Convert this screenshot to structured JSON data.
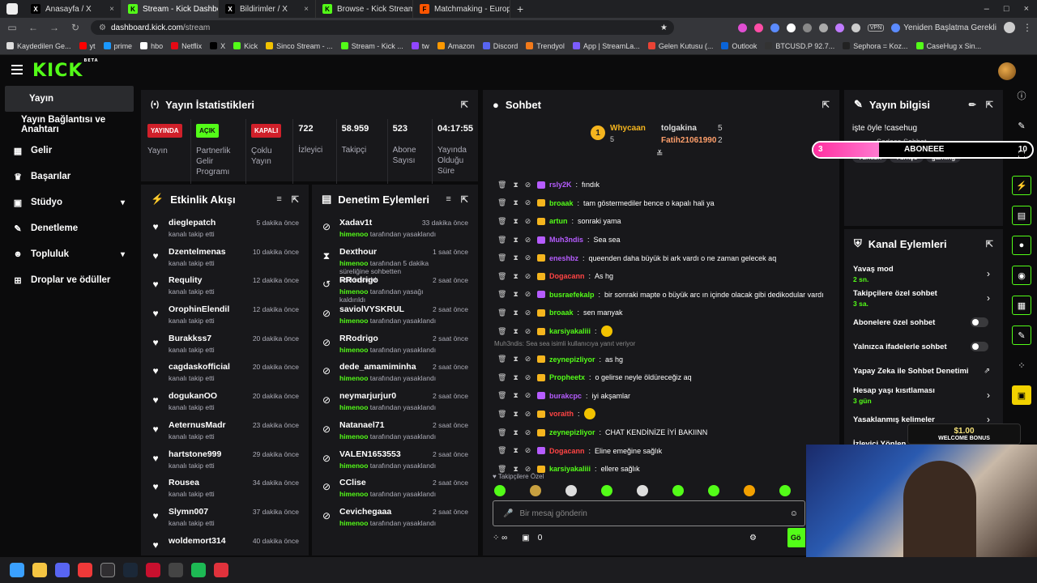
{
  "browser": {
    "tabs": [
      {
        "label": "Anasayfa / X",
        "fav": "X",
        "color": "#000000"
      },
      {
        "label": "Stream - Kick Dashboard",
        "fav": "K",
        "color": "#53fc18",
        "active": true
      },
      {
        "label": "Bildirimler / X",
        "fav": "X",
        "color": "#000000"
      },
      {
        "label": "Browse - Kick Streaming",
        "fav": "K",
        "color": "#53fc18"
      },
      {
        "label": "Matchmaking - Europe 5v5",
        "fav": "F",
        "color": "#ff5500"
      }
    ],
    "url_domain": "dashboard.kick.com",
    "url_path": "/stream",
    "vpn_label": "VPN",
    "restart_label": "Yeniden Başlatma Gerekli",
    "bookmarks": [
      "Kaydedilen Ge...",
      "yt",
      "prime",
      "hbo",
      "Netflix",
      "X",
      "Kick",
      "Sinco Stream - ...",
      "Stream - Kick ...",
      "tw",
      "Amazon",
      "Discord",
      "Trendyol",
      "App | StreamLa...",
      "Gelen Kutusu (...",
      "Outlook",
      "BTCUSD.P 92.7...",
      "Sephora = Koz...",
      "CaseHug x Sin..."
    ]
  },
  "app": {
    "logo": "KICK",
    "logo_sup": "BETA",
    "sidebar": [
      {
        "label": "Yayın",
        "icon": "broadcast-icon",
        "glyph": "▸"
      },
      {
        "label": "Yayın Bağlantısı ve Anahtarı",
        "icon": "",
        "glyph": ""
      },
      {
        "label": "Gelir",
        "icon": "revenue-icon",
        "glyph": "▦"
      },
      {
        "label": "Başarılar",
        "icon": "trophy-icon",
        "glyph": "♛"
      },
      {
        "label": "Stüdyo",
        "icon": "studio-icon",
        "glyph": "▣",
        "chev": "⌄"
      },
      {
        "label": "Denetleme",
        "icon": "wrench-icon",
        "glyph": "✎"
      },
      {
        "label": "Topluluk",
        "icon": "community-icon",
        "glyph": "☻",
        "chev": "⌄"
      },
      {
        "label": "Droplar ve ödüller",
        "icon": "gift-icon",
        "glyph": "⊞"
      }
    ]
  },
  "stats": {
    "title": "Yayın İstatistikleri",
    "items": [
      {
        "badge": "YAYINDA",
        "badge_style": "red",
        "label": "Yayın"
      },
      {
        "badge": "AÇIK",
        "badge_style": "green",
        "label": "Partnerlik Gelir Programı"
      },
      {
        "badge": "KAPALI",
        "badge_style": "red",
        "label": "Çoklu Yayın"
      },
      {
        "value": "722",
        "label": "İzleyici"
      },
      {
        "value": "58.959",
        "label": "Takipçi"
      },
      {
        "value": "523",
        "label": "Abone Sayısı"
      },
      {
        "value": "04:17:55",
        "label": "Yayında Olduğu Süre"
      }
    ]
  },
  "activity": {
    "title": "Etkinlik Akışı",
    "items": [
      {
        "name": "dieglepatch",
        "sub": "kanalı takip etti",
        "time": "5 dakika önce"
      },
      {
        "name": "Dzentelmenas",
        "sub": "kanalı takip etti",
        "time": "10 dakika önce"
      },
      {
        "name": "Requlity",
        "sub": "kanalı takip etti",
        "time": "12 dakika önce"
      },
      {
        "name": "OrophinElendil",
        "sub": "kanalı takip etti",
        "time": "12 dakika önce"
      },
      {
        "name": "Burakkss7",
        "sub": "kanalı takip etti",
        "time": "20 dakika önce"
      },
      {
        "name": "cagdaskofficial",
        "sub": "kanalı takip etti",
        "time": "20 dakika önce"
      },
      {
        "name": "dogukanOO",
        "sub": "kanalı takip etti",
        "time": "20 dakika önce"
      },
      {
        "name": "AeternusMadr",
        "sub": "kanalı takip etti",
        "time": "23 dakika önce"
      },
      {
        "name": "hartstone999",
        "sub": "kanalı takip etti",
        "time": "29 dakika önce"
      },
      {
        "name": "Rousea",
        "sub": "kanalı takip etti",
        "time": "34 dakika önce"
      },
      {
        "name": "Slymn007",
        "sub": "kanalı takip etti",
        "time": "37 dakika önce"
      },
      {
        "name": "woldemort314",
        "sub": "",
        "time": "40 dakika önce"
      }
    ]
  },
  "moderation": {
    "title": "Denetim Eylemleri",
    "items": [
      {
        "name": "Xadav1t",
        "mod": "himenoo",
        "sub": " tarafından yasaklandı",
        "time": "33 dakika önce",
        "glyph": "⊘"
      },
      {
        "name": "Dexthour",
        "mod": "himenoo",
        "sub": " tarafından 5 dakika süreliğine sohbetten uzaklaştırıldı",
        "time": "1 saat önce",
        "glyph": "⧗"
      },
      {
        "name": "RRodrigo",
        "mod": "himenoo",
        "sub": " tarafından yasağı kaldırıldı",
        "time": "2 saat önce",
        "glyph": "↺"
      },
      {
        "name": "saviolVYSKRUL",
        "mod": "himenoo",
        "sub": " tarafından yasaklandı",
        "time": "2 saat önce",
        "glyph": "⊘"
      },
      {
        "name": "RRodrigo",
        "mod": "himenoo",
        "sub": " tarafından yasaklandı",
        "time": "2 saat önce",
        "glyph": "⊘"
      },
      {
        "name": "dede_amamiminha",
        "mod": "himenoo",
        "sub": " tarafından yasaklandı",
        "time": "2 saat önce",
        "glyph": "⊘"
      },
      {
        "name": "neymarjurjur0",
        "mod": "himenoo",
        "sub": " tarafından yasaklandı",
        "time": "2 saat önce",
        "glyph": "⊘"
      },
      {
        "name": "Natanael71",
        "mod": "himenoo",
        "sub": " tarafından yasaklandı",
        "time": "2 saat önce",
        "glyph": "⊘"
      },
      {
        "name": "VALEN1653553",
        "mod": "himenoo",
        "sub": " tarafından yasaklandı",
        "time": "2 saat önce",
        "glyph": "⊘"
      },
      {
        "name": "CClise",
        "mod": "himenoo",
        "sub": " tarafından yasaklandı",
        "time": "2 saat önce",
        "glyph": "⊘"
      },
      {
        "name": "Cevichegaaa",
        "mod": "himenoo",
        "sub": " tarafından yasaklandı",
        "time": "2 saat önce",
        "glyph": "⊘"
      }
    ]
  },
  "chat": {
    "title": "Sohbet",
    "top": {
      "rank": "1",
      "name": "Whycaan",
      "count": "5",
      "second": "tolgakina",
      "second_count": "5",
      "third": "Fatih21061990",
      "third_count": "2"
    },
    "messages": [
      {
        "user": "rsly2K",
        "color": "#b65cff",
        "text": "fındık"
      },
      {
        "user": "broaak",
        "color": "#53fc18",
        "text": "tam göstermediler bence o kapalı hali ya"
      },
      {
        "user": "artun",
        "color": "#53fc18",
        "text": "sonraki yama"
      },
      {
        "user": "Muh3ndis",
        "color": "#b65cff",
        "text": "Sea sea"
      },
      {
        "user": "eneshbz",
        "color": "#b65cff",
        "text": "queenden daha büyük bi ark vardı o ne zaman gelecek aq"
      },
      {
        "user": "Dogacann",
        "color": "#ff4444",
        "text": "As hg"
      },
      {
        "user": "busraefekalp",
        "color": "#53fc18",
        "text": "bir sonraki mapte o büyük arc ın içinde olacak gibi dedikodular vardı"
      },
      {
        "user": "broaak",
        "color": "#53fc18",
        "text": "sen manyak"
      },
      {
        "user": "karsiyakaliii",
        "color": "#53fc18",
        "text": ""
      },
      {
        "reply": "Muh3ndis: Sea sea isimli kullanıcıya yanıt veriyor"
      },
      {
        "user": "zeynepizliyor",
        "color": "#53fc18",
        "text": "as hg"
      },
      {
        "user": "Propheetx",
        "color": "#53fc18",
        "text": "o gelirse neyle öldüreceğiz aq"
      },
      {
        "user": "burakcpc",
        "color": "#b65cff",
        "text": "iyi akşamlar"
      },
      {
        "user": "voraith",
        "color": "#ff4444",
        "text": ""
      },
      {
        "user": "zeynepizliyor",
        "color": "#53fc18",
        "text": "CHAT KENDİNİZE İYİ BAKIINN"
      },
      {
        "user": "Dogacann",
        "color": "#ff4444",
        "text": "Eline emeğine sağlık"
      },
      {
        "user": "karsiyakaliii",
        "color": "#53fc18",
        "text": "ellere sağlık"
      }
    ],
    "followers_only": "Takipçilere Özel",
    "placeholder": "Bir mesaj gönderin",
    "counter": "0",
    "send": "Gö"
  },
  "info": {
    "title": "Yayın bilgisi",
    "stream_title": "işte öyle !casehug",
    "line2": "Sadece Sohbet",
    "tags": [
      "Turkish",
      "Türkçe",
      "gaming"
    ],
    "overlay": {
      "left": "3",
      "label": "ABONEEE",
      "right": "10"
    }
  },
  "channel_actions": {
    "title": "Kanal Eylemleri",
    "items": [
      {
        "title": "Yavaş mod",
        "sub": "2 sn.",
        "kind": "arrow"
      },
      {
        "title": "Takipçilere özel sohbet",
        "sub": "3 sa.",
        "kind": "arrow"
      },
      {
        "title": "Abonelere özel sohbet",
        "sub": "",
        "kind": "toggle"
      },
      {
        "title": "Yalnızca ifadelerle sohbet",
        "sub": "",
        "kind": "toggle"
      },
      {
        "title": "Yapay Zeka ile Sohbet Denetimi",
        "sub": "",
        "kind": "ext"
      },
      {
        "title": "Hesap yaşı kısıtlaması",
        "sub": "3 gün",
        "kind": "arrow"
      },
      {
        "title": "Yasaklanmış kelimeler",
        "sub": "",
        "kind": "arrow"
      },
      {
        "title": "İzleyici Yönlen...",
        "sub": "",
        "kind": "none"
      }
    ]
  },
  "promo": {
    "price": "$1.00",
    "text": "WELCOME BONUS"
  }
}
